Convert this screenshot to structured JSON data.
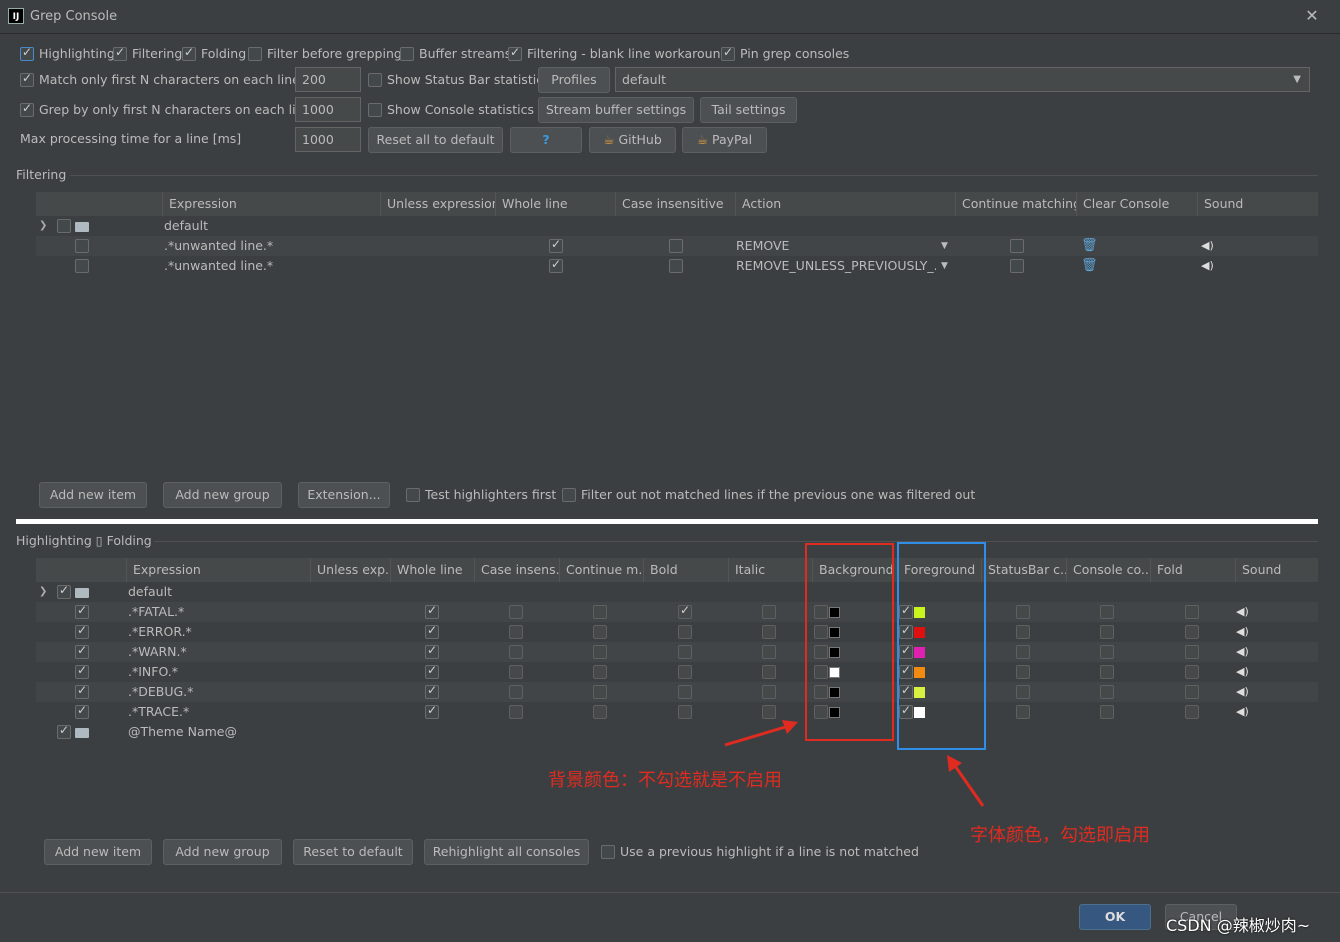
{
  "window": {
    "title": "Grep Console",
    "icon_text": "IJ",
    "close_glyph": "✕"
  },
  "options": {
    "row1": [
      {
        "label": "Highlighting",
        "checked": true
      },
      {
        "label": "Filtering",
        "checked": true
      },
      {
        "label": "Folding",
        "checked": true
      },
      {
        "label": "Filter before grepping",
        "checked": false
      },
      {
        "label": "Buffer streams",
        "checked": false
      },
      {
        "label": "Filtering - blank line workaround",
        "checked": true
      },
      {
        "label": "Pin grep consoles",
        "checked": true
      }
    ],
    "match_first_n": {
      "label": "Match only first N characters on each line",
      "value": "200",
      "checked": true
    },
    "grep_first_n": {
      "label": "Grep by only first N characters on each line",
      "value": "1000",
      "checked": true
    },
    "max_processing": {
      "label": "Max processing time for a line [ms]",
      "value": "1000"
    },
    "status_bar_stats": {
      "label": "Show Status Bar statistics",
      "checked": false
    },
    "console_stats": {
      "label": "Show Console statistics",
      "checked": false
    },
    "profiles_button": "Profiles",
    "profile_value": "default",
    "stream_buffer_button": "Stream buffer settings",
    "tail_button": "Tail settings",
    "reset_button": "Reset all to default",
    "help_button": "?",
    "github_button": "GitHub",
    "paypal_button": "PayPal"
  },
  "filtering": {
    "section_title": "Filtering",
    "columns": [
      "Expression",
      "Unless expression",
      "Whole line",
      "Case insensitive",
      "Action",
      "Continue matching",
      "Clear Console",
      "Sound"
    ],
    "group": "default",
    "rows": [
      {
        "expression": ".*unwanted line.*",
        "whole_line": true,
        "case_insensitive": false,
        "action": "REMOVE",
        "continue": false
      },
      {
        "expression": ".*unwanted line.*",
        "whole_line": true,
        "case_insensitive": false,
        "action": "REMOVE_UNLESS_PREVIOUSLY_...",
        "continue": false
      }
    ],
    "buttons": {
      "add_item": "Add new item",
      "add_group": "Add new group",
      "extension": "Extension..."
    },
    "test_highlighters": "Test highlighters first",
    "filter_out": "Filter out not matched lines if the previous one was filtered out"
  },
  "highlighting": {
    "section_title": "Highlighting ▯ Folding",
    "columns": [
      "Expression",
      "Unless exp...",
      "Whole line",
      "Case insens...",
      "Continue m...",
      "Bold",
      "Italic",
      "Background",
      "Foreground",
      "StatusBar c...",
      "Console co...",
      "Fold",
      "Sound"
    ],
    "group": "default",
    "rows": [
      {
        "expression": ".*FATAL.*",
        "bold": true,
        "fg_color": "#c8f51e",
        "bg_color": "#000000"
      },
      {
        "expression": ".*ERROR.*",
        "bold": false,
        "fg_color": "#e01010",
        "bg_color": "#000000"
      },
      {
        "expression": ".*WARN.*",
        "bold": false,
        "fg_color": "#e020b0",
        "bg_color": "#000000"
      },
      {
        "expression": ".*INFO.*",
        "bold": false,
        "fg_color": "#f08a10",
        "bg_color": "#ffffff"
      },
      {
        "expression": ".*DEBUG.*",
        "bold": false,
        "fg_color": "#d8f040",
        "bg_color": "#000000"
      },
      {
        "expression": ".*TRACE.*",
        "bold": false,
        "fg_color": "#ffffff",
        "bg_color": "#000000"
      }
    ],
    "theme_group": "@Theme Name@",
    "buttons": {
      "add_item": "Add new item",
      "add_group": "Add new group",
      "reset": "Reset to default",
      "rehighlight": "Rehighlight all consoles"
    },
    "use_previous": "Use a previous highlight if a line is not matched"
  },
  "annotations": {
    "background_note": "背景颜色：不勾选就是不启用",
    "foreground_note": "字体颜色，勾选即启用",
    "red": "#e02b20",
    "blue": "#2f8ee8"
  },
  "footer": {
    "ok": "OK",
    "cancel": "Cancel"
  },
  "watermark": "CSDN @辣椒炒肉~"
}
